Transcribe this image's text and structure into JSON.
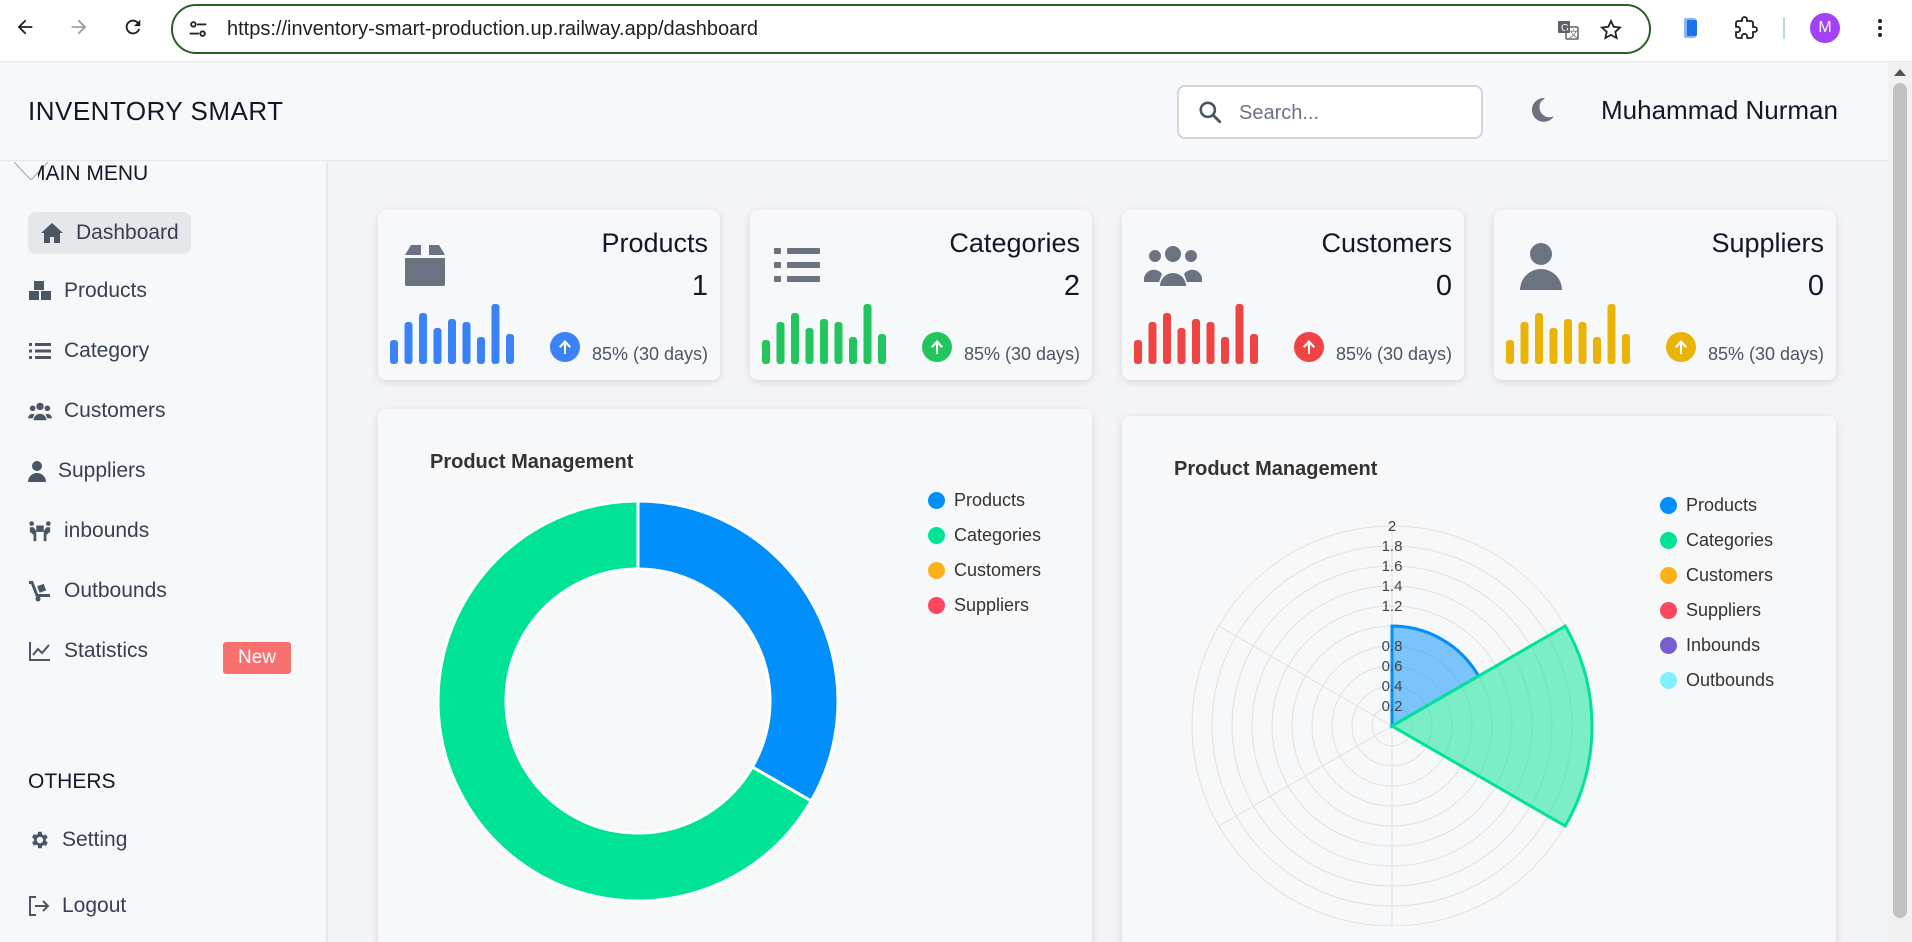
{
  "browser": {
    "url": "https://inventory-smart-production.up.railway.app/dashboard",
    "avatar_letter": "M"
  },
  "header": {
    "brand": "INVENTORY SMART",
    "search_placeholder": "Search...",
    "username": "Muhammad Nurman"
  },
  "sidebar": {
    "main_heading": "MAIN MENU",
    "items": [
      {
        "label": "Dashboard",
        "icon": "home-icon"
      },
      {
        "label": "Products",
        "icon": "boxes-icon"
      },
      {
        "label": "Category",
        "icon": "list-icon"
      },
      {
        "label": "Customers",
        "icon": "users-icon"
      },
      {
        "label": "Suppliers",
        "icon": "user-icon"
      },
      {
        "label": "inbounds",
        "icon": "people-carry-icon"
      },
      {
        "label": "Outbounds",
        "icon": "dolly-icon"
      },
      {
        "label": "Statistics",
        "icon": "chart-line-icon",
        "badge": "New"
      }
    ],
    "others_heading": "OTHERS",
    "others": [
      {
        "label": "Setting",
        "icon": "gear-icon"
      },
      {
        "label": "Logout",
        "icon": "logout-icon"
      }
    ]
  },
  "stats": [
    {
      "label": "Products",
      "value": "1",
      "trend": "85% (30 days)",
      "color": "#3b82f6",
      "icon": "box-icon"
    },
    {
      "label": "Categories",
      "value": "2",
      "trend": "85% (30 days)",
      "color": "#22c55e",
      "icon": "list-icon"
    },
    {
      "label": "Customers",
      "value": "0",
      "trend": "85% (30 days)",
      "color": "#ef4444",
      "icon": "users-icon"
    },
    {
      "label": "Suppliers",
      "value": "0",
      "trend": "85% (30 days)",
      "color": "#eab308",
      "icon": "user-icon"
    }
  ],
  "sparkline_values": [
    0.4,
    0.7,
    0.85,
    0.6,
    0.75,
    0.7,
    0.45,
    1.0,
    0.5
  ],
  "chart_data": [
    {
      "type": "pie",
      "title": "Product Management",
      "categories": [
        "Products",
        "Categories",
        "Customers",
        "Suppliers"
      ],
      "values": [
        1,
        2,
        0,
        0
      ],
      "colors": [
        "#008ffb",
        "#00e396",
        "#feb019",
        "#ff4560"
      ],
      "donut": true,
      "legend": "top-right"
    },
    {
      "type": "polar-area",
      "title": "Product Management",
      "categories": [
        "Products",
        "Categories",
        "Customers",
        "Suppliers",
        "Inbounds",
        "Outbounds"
      ],
      "values": [
        1,
        2,
        0,
        0,
        0,
        0
      ],
      "colors": [
        "#008ffb",
        "#00e396",
        "#feb019",
        "#ff4560",
        "#775dd0",
        "#80effe"
      ],
      "r_ticks": [
        "0.2",
        "0.4",
        "0.6",
        "0.8",
        "1.2",
        "1.4",
        "1.6",
        "1.8",
        "2"
      ],
      "r_max": 2,
      "legend": "top-right"
    }
  ]
}
